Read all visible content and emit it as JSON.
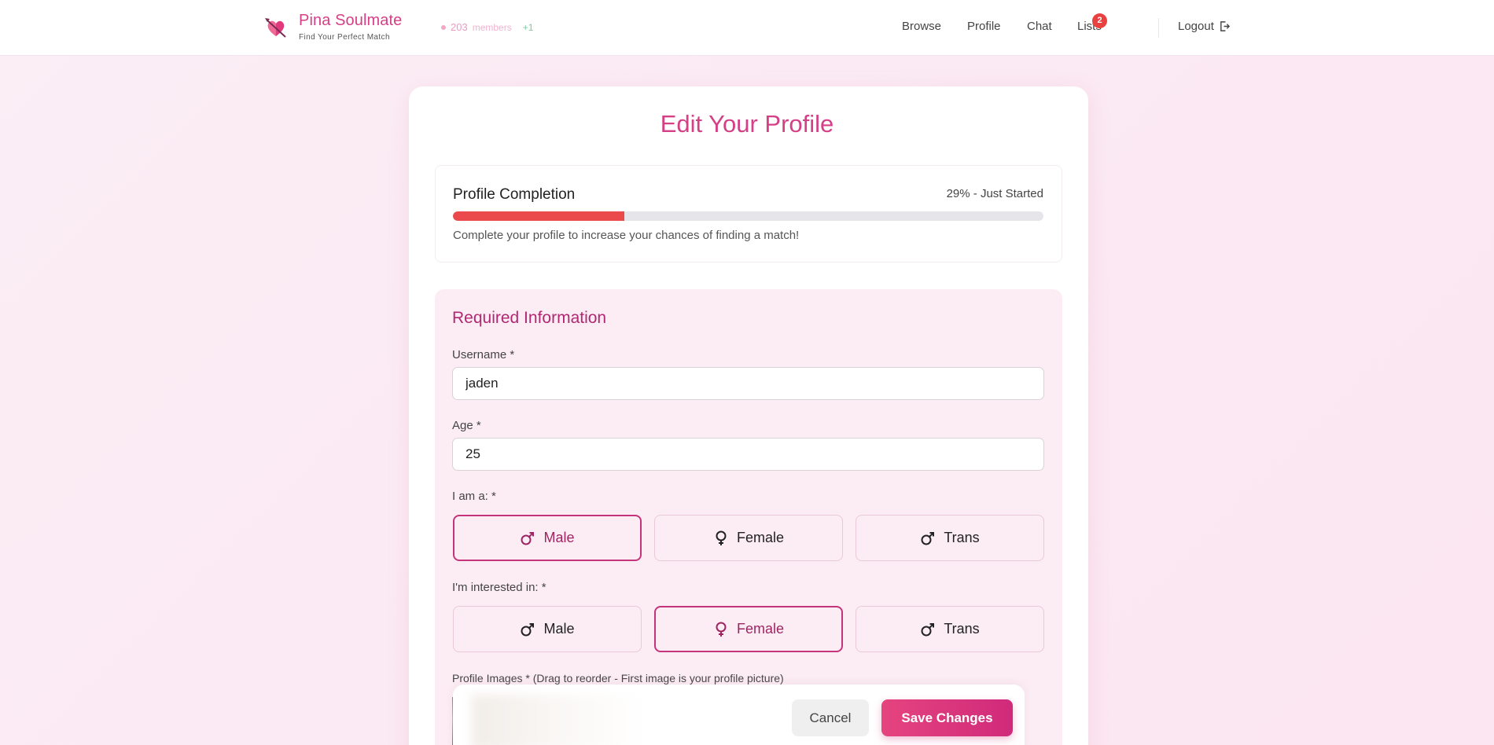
{
  "brand": {
    "name": "Pina Soulmate",
    "tagline": "Find Your Perfect Match",
    "member_count": "203",
    "member_label": "members",
    "member_delta": "+1"
  },
  "nav": {
    "browse": "Browse",
    "profile": "Profile",
    "chat": "Chat",
    "lists": "Lists",
    "lists_badge": "2",
    "logout": "Logout"
  },
  "page": {
    "title": "Edit Your Profile"
  },
  "completion": {
    "title": "Profile Completion",
    "status": "29% - Just Started",
    "percent": 29,
    "hint": "Complete your profile to increase your chances of finding a match!"
  },
  "required": {
    "title": "Required Information",
    "username_label": "Username *",
    "username_value": "jaden",
    "age_label": "Age *",
    "age_value": "25",
    "gender_label": "I am a: *",
    "gender_options": [
      "Male",
      "Female",
      "Trans"
    ],
    "gender_selected": "Male",
    "interest_label": "I'm interested in: *",
    "interest_options": [
      "Male",
      "Female",
      "Trans"
    ],
    "interest_selected": "Female",
    "images_label": "Profile Images * (Drag to reorder - First image is your profile picture)"
  },
  "actions": {
    "cancel": "Cancel",
    "save": "Save Changes"
  },
  "colors": {
    "brand": "#d53f86",
    "section_title": "#b02872",
    "progress": "#ea4a4c",
    "badge": "#e8413f"
  }
}
